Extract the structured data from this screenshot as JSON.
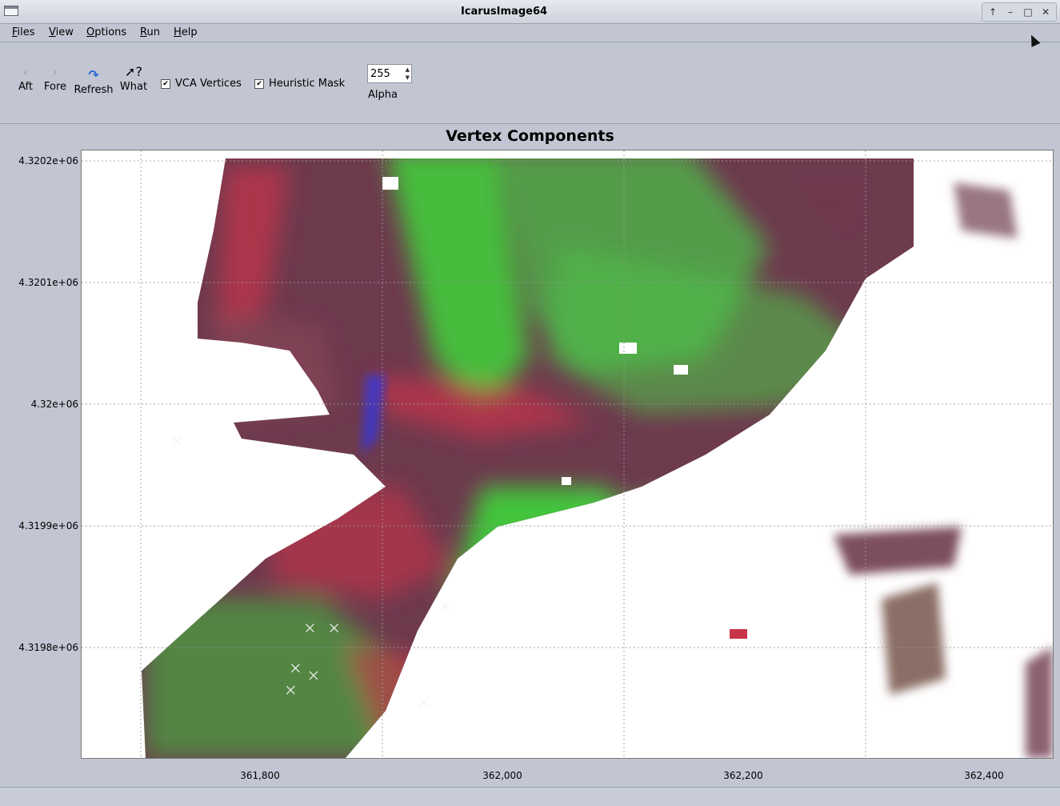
{
  "window": {
    "title": "IcarusImage64"
  },
  "window_controls": [
    "↑",
    "–",
    "□",
    "✕"
  ],
  "menu": {
    "items": [
      "Files",
      "View",
      "Options",
      "Run",
      "Help"
    ]
  },
  "toolbar": {
    "aft_label": "Aft",
    "fore_label": "Fore",
    "refresh_label": "Refresh",
    "what_label": "What",
    "vca_vertices_label": "VCA Vertices",
    "vca_vertices_checked": true,
    "heuristic_mask_label": "Heuristic Mask",
    "heuristic_mask_checked": true,
    "alpha_value": "255",
    "alpha_label": "Alpha"
  },
  "plot": {
    "title": "Vertex Components",
    "y_ticks": [
      "4.3202e+06",
      "4.3201e+06",
      "4.32e+06",
      "4.3199e+06",
      "4.3198e+06"
    ],
    "x_ticks": [
      "361,800",
      "362,000",
      "362,200",
      "362,400"
    ],
    "colors": {
      "red": "#c8344a",
      "green": "#3fd43a",
      "purple": "#6e3a4e",
      "blue": "#3a3ad8",
      "mask": "#ffffff"
    },
    "vertex_markers": [
      {
        "x": 361830,
        "y": 4319970
      },
      {
        "x": 361940,
        "y": 4319816
      },
      {
        "x": 361960,
        "y": 4319816
      },
      {
        "x": 361928,
        "y": 4319783
      },
      {
        "x": 361943,
        "y": 4319777
      },
      {
        "x": 361924,
        "y": 4319765
      },
      {
        "x": 362052,
        "y": 4319834
      },
      {
        "x": 362034,
        "y": 4319755
      }
    ]
  }
}
